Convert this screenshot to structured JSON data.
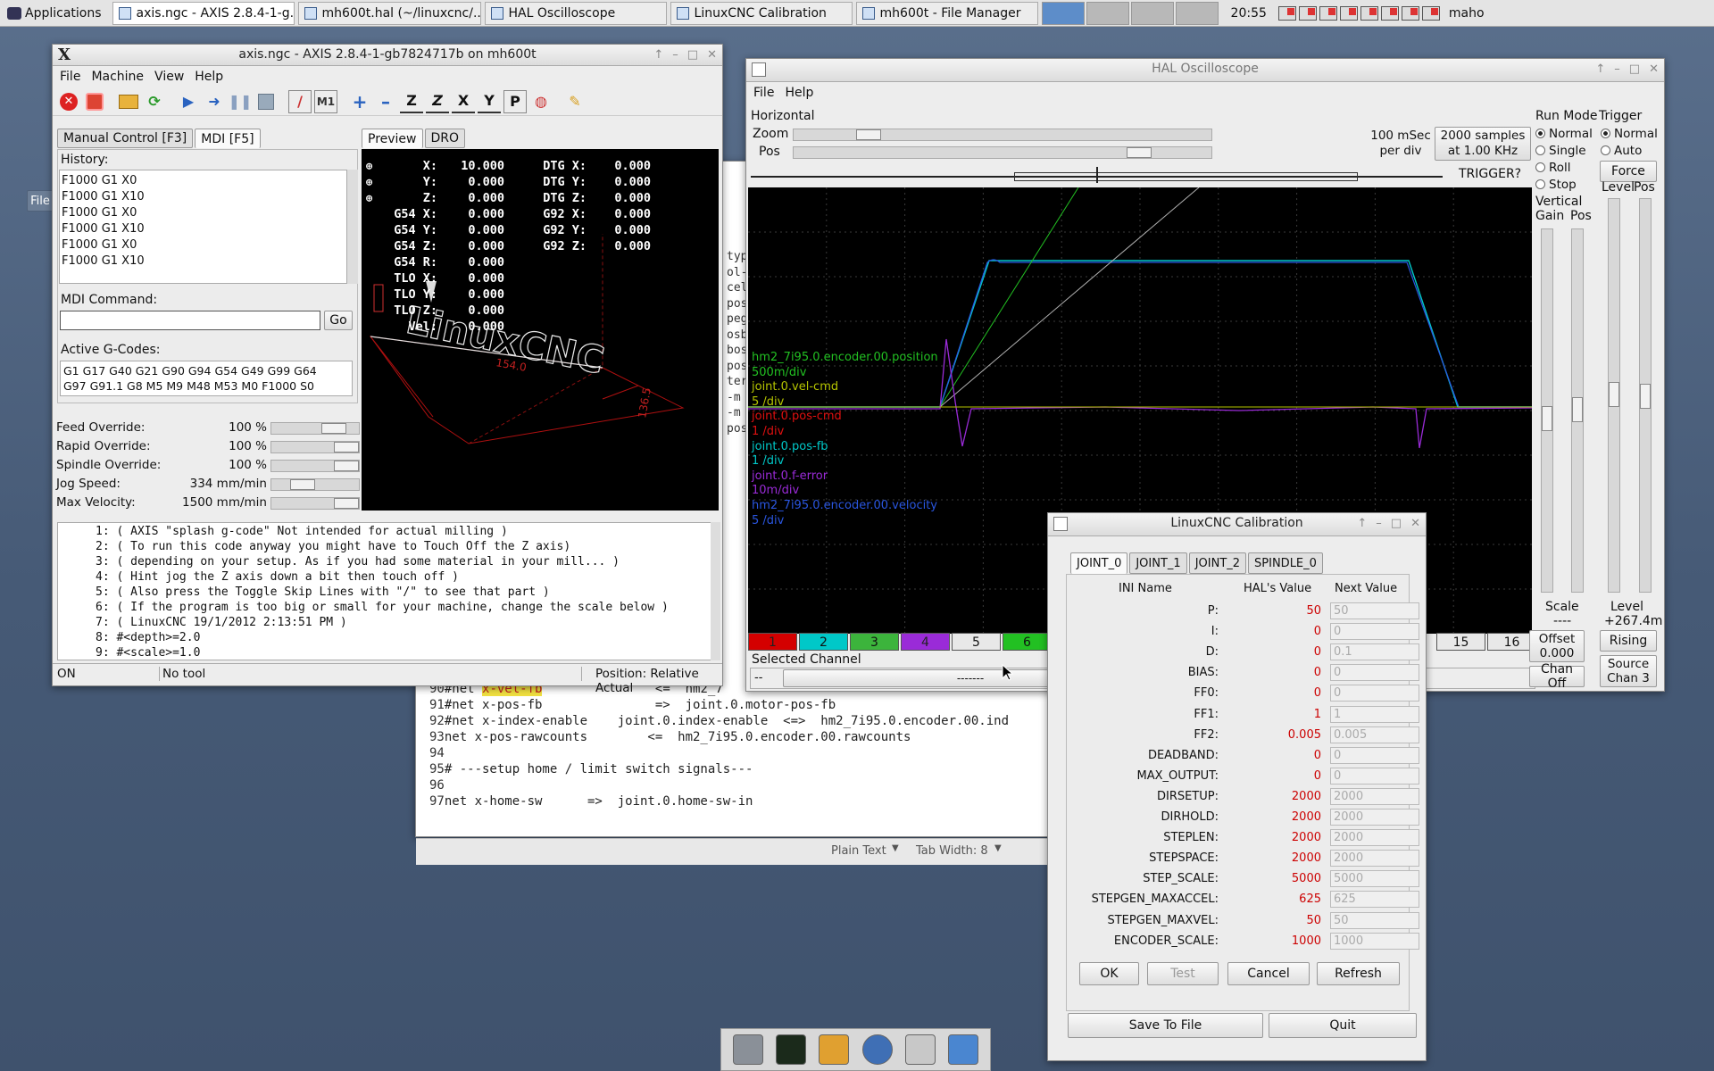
{
  "taskbar": {
    "applications_label": "Applications",
    "tasks": [
      {
        "label": "axis.ngc - AXIS 2.8.4-1-g...",
        "active": true
      },
      {
        "label": "mh600t.hal (~/linuxcnc/...",
        "active": false
      },
      {
        "label": "HAL Oscilloscope",
        "active": false
      },
      {
        "label": "LinuxCNC Calibration",
        "active": false
      },
      {
        "label": "mh600t - File Manager",
        "active": false
      }
    ],
    "clock": "20:55",
    "user": "maho"
  },
  "axis": {
    "title": "axis.ngc - AXIS 2.8.4-1-gb7824717b on mh600t",
    "x_logo": "X",
    "menu": [
      "File",
      "Machine",
      "View",
      "Help"
    ],
    "tabs": [
      "Manual Control [F3]",
      "MDI [F5]"
    ],
    "preview_tabs": [
      "Preview",
      "DRO"
    ],
    "history_label": "History:",
    "history": [
      "F1000 G1 X0",
      "F1000 G1 X10",
      "F1000 G1 X0",
      "F1000 G1 X10",
      "F1000 G1 X0",
      "F1000 G1 X10"
    ],
    "mdi_label": "MDI Command:",
    "mdi_value": "",
    "go_label": "Go",
    "active_gcodes_label": "Active G-Codes:",
    "active_gcodes": [
      "G1 G17 G40 G21 G90 G94 G54 G49 G99 G64",
      "G97 G91.1 G8 M5 M9 M48 M53 M0 F1000 S0"
    ],
    "overrides": [
      {
        "label": "Feed Override:",
        "value": "100 %",
        "level": 0.8
      },
      {
        "label": "Rapid Override:",
        "value": "100 %",
        "level": 1.0
      },
      {
        "label": "Spindle Override:",
        "value": "100 %",
        "level": 1.0
      },
      {
        "label": "Jog Speed:",
        "value": "334 mm/min",
        "level": 0.3
      },
      {
        "label": "Max Velocity:",
        "value": "1500 mm/min",
        "level": 1.0
      }
    ],
    "dro": [
      {
        "a": "X:",
        "av": "10.000",
        "b": "DTG X:",
        "bv": "0.000"
      },
      {
        "a": "Y:",
        "av": "0.000",
        "b": "DTG Y:",
        "bv": "0.000"
      },
      {
        "a": "Z:",
        "av": "0.000",
        "b": "DTG Z:",
        "bv": "0.000"
      },
      {
        "a": "G54 X:",
        "av": "0.000",
        "b": "G92 X:",
        "bv": "0.000"
      },
      {
        "a": "G54 Y:",
        "av": "0.000",
        "b": "G92 Y:",
        "bv": "0.000"
      },
      {
        "a": "G54 Z:",
        "av": "0.000",
        "b": "G92 Z:",
        "bv": "0.000"
      },
      {
        "a": "G54 R:",
        "av": "0.000",
        "b": "",
        "bv": ""
      },
      {
        "a": "TLO X:",
        "av": "0.000",
        "b": "",
        "bv": ""
      },
      {
        "a": "TLO Y:",
        "av": "0.000",
        "b": "",
        "bv": ""
      },
      {
        "a": "TLO Z:",
        "av": "0.000",
        "b": "",
        "bv": ""
      },
      {
        "a": "Vel:",
        "av": "0.000",
        "b": "",
        "bv": ""
      }
    ],
    "preview_logo": "LinuxCNC",
    "dim_x": "154.0",
    "dim_y": "136.5",
    "code": [
      "1: ( AXIS \"splash g-code\" Not intended for actual milling )",
      "2: ( To run this code anyway you might have to Touch Off the Z axis)",
      "3: ( depending on your setup. As if you had some material in your mill... )",
      "4: ( Hint jog the Z axis down a bit then touch off )",
      "5: ( Also press the Toggle Skip Lines with \"/\" to see that part )",
      "6: ( If the program is too big or small for your machine, change the scale below )",
      "7: ( LinuxCNC 19/1/2012 2:13:51 PM )",
      "8: #<depth>=2.0",
      "9: #<scale>=1.0"
    ],
    "status": {
      "state": "ON",
      "tool": "No tool",
      "position": "Position: Relative Actual"
    }
  },
  "editor": {
    "side_fragments": [
      "typ",
      "ol-",
      "cel",
      "pos",
      "peg",
      "osb",
      "bos",
      "pos",
      "ter",
      "-m",
      "-m",
      "pos"
    ],
    "lines": [
      {
        "n": "90",
        "pre": "#net ",
        "hl": "x-vel-fb",
        "post": "               <=  hm2_7"
      },
      {
        "n": "91",
        "pre": "#net x-pos-fb               =>  joint.0.motor-pos-fb",
        "hl": "",
        "post": ""
      },
      {
        "n": "92",
        "pre": "#net x-index-enable    joint.0.index-enable  <=>  hm2_7i95.0.encoder.00.ind",
        "hl": "",
        "post": ""
      },
      {
        "n": "93",
        "pre": "net x-pos-rawcounts        <=  hm2_7i95.0.encoder.00.rawcounts",
        "hl": "",
        "post": ""
      },
      {
        "n": "94",
        "pre": "",
        "hl": "",
        "post": ""
      },
      {
        "n": "95",
        "pre": "# ---setup home / limit switch signals---",
        "hl": "",
        "post": ""
      },
      {
        "n": "96",
        "pre": "",
        "hl": "",
        "post": ""
      },
      {
        "n": "97",
        "pre": "net x-home-sw      =>  joint.0.home-sw-in",
        "hl": "",
        "post": ""
      }
    ],
    "plain_text": "Plain Text",
    "tab_width": "Tab Width: 8"
  },
  "scope": {
    "title": "HAL Oscilloscope",
    "menu": [
      "File",
      "Help"
    ],
    "horizontal_label": "Horizontal",
    "zoom_label": "Zoom",
    "pos_label": "Pos",
    "rate_text": "100 mSec",
    "rate_text2": "per div",
    "samples_text": "2000 samples",
    "samples_text2": "at 1.00 KHz",
    "trigger_q": "TRIGGER?",
    "run_mode_label": "Run Mode",
    "run_modes": [
      "Normal",
      "Single",
      "Roll",
      "Stop"
    ],
    "trigger_label": "Trigger",
    "trigger_modes": [
      "Normal",
      "Auto"
    ],
    "force_label": "Force",
    "vertical_label": "Vertical",
    "gain_label": "Gain",
    "pos_label2": "Pos",
    "level_label": "Level",
    "pos_label3": "Pos",
    "scale_label": "Scale",
    "scale_value": "----",
    "level_label2": "Level",
    "level_value": "+267.4m",
    "offset_label": "Offset",
    "offset_value": "0.000",
    "rising_label": "Rising",
    "chan_off_label": "Chan Off",
    "source_label": "Source",
    "source_value": "Chan  3",
    "selected_channel_label": "Selected Channel",
    "selected_channel_value": "--",
    "selected_channel_dashes": "-------",
    "channels": [
      {
        "n": "1",
        "color": "#d40000"
      },
      {
        "n": "2",
        "color": "#00c8c8"
      },
      {
        "n": "3",
        "color": "#3cb43c"
      },
      {
        "n": "4",
        "color": "#9a2bd8"
      },
      {
        "n": "5",
        "color": "#e8e8e8"
      },
      {
        "n": "6",
        "color": "#22c022"
      },
      {
        "n": "15",
        "color": "#e8e8e8"
      },
      {
        "n": "16",
        "color": "#e8e8e8"
      }
    ],
    "legend": [
      {
        "name": "hm2_7i95.0.encoder.00.position",
        "scale": "500m/div",
        "color": "#22c022"
      },
      {
        "name": "joint.0.vel-cmd",
        "scale": "5 /div",
        "color": "#b5c400"
      },
      {
        "name": "joint.0.pos-cmd",
        "scale": "1 /div",
        "color": "#e01010"
      },
      {
        "name": "joint.0.pos-fb",
        "scale": "1 /div",
        "color": "#00c8c8"
      },
      {
        "name": "joint.0.f-error",
        "scale": "10m/div",
        "color": "#9a2bd8"
      },
      {
        "name": "hm2_7i95.0.encoder.00.velocity",
        "scale": "5 /div",
        "color": "#2a56e0"
      }
    ]
  },
  "calibration": {
    "title": "LinuxCNC Calibration",
    "tabs": [
      "JOINT_0",
      "JOINT_1",
      "JOINT_2",
      "SPINDLE_0"
    ],
    "col_ini": "INI Name",
    "col_hal": "HAL's Value",
    "col_next": "Next Value",
    "rows": [
      {
        "name": "P:",
        "hal": "50",
        "next": "50"
      },
      {
        "name": "I:",
        "hal": "0",
        "next": "0"
      },
      {
        "name": "D:",
        "hal": "0",
        "next": "0.1"
      },
      {
        "name": "BIAS:",
        "hal": "0",
        "next": "0"
      },
      {
        "name": "FF0:",
        "hal": "0",
        "next": "0"
      },
      {
        "name": "FF1:",
        "hal": "1",
        "next": "1"
      },
      {
        "name": "FF2:",
        "hal": "0.005",
        "next": "0.005"
      },
      {
        "name": "DEADBAND:",
        "hal": "0",
        "next": "0"
      },
      {
        "name": "MAX_OUTPUT:",
        "hal": "0",
        "next": "0"
      },
      {
        "name": "DIRSETUP:",
        "hal": "2000",
        "next": "2000"
      },
      {
        "name": "DIRHOLD:",
        "hal": "2000",
        "next": "2000"
      },
      {
        "name": "STEPLEN:",
        "hal": "2000",
        "next": "2000"
      },
      {
        "name": "STEPSPACE:",
        "hal": "2000",
        "next": "2000"
      },
      {
        "name": "STEP_SCALE:",
        "hal": "5000",
        "next": "5000"
      },
      {
        "name": "STEPGEN_MAXACCEL:",
        "hal": "625",
        "next": "625"
      },
      {
        "name": "STEPGEN_MAXVEL:",
        "hal": "50",
        "next": "50"
      },
      {
        "name": "ENCODER_SCALE:",
        "hal": "1000",
        "next": "1000"
      }
    ],
    "ok": "OK",
    "test": "Test",
    "cancel": "Cancel",
    "refresh": "Refresh",
    "save": "Save To File",
    "quit": "Quit"
  },
  "desktop_fragment": "File"
}
